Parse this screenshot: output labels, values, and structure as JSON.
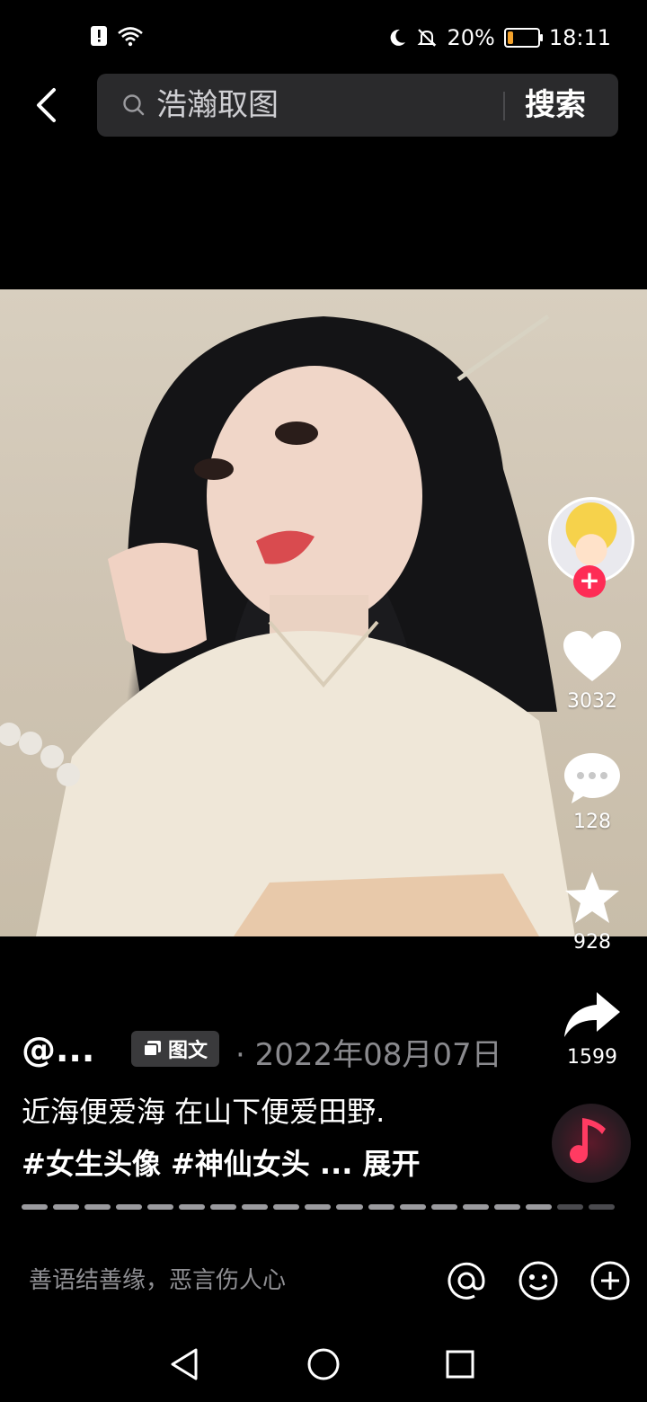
{
  "status_bar": {
    "battery": "20%",
    "time": "18:11",
    "battery_level": 0.2
  },
  "search": {
    "query": "浩瀚取图",
    "button": "搜索"
  },
  "post": {
    "username": "@...",
    "type_badge": "图文",
    "separator": "·",
    "date": "2022年08月07日",
    "caption_line1": "近海便爱海 在山下便爱田野.",
    "caption_line2": "#女生头像 #神仙女头 ...",
    "expand": "展开",
    "progress": {
      "total": 19,
      "current": 17
    }
  },
  "actions": {
    "likes": "3032",
    "comments": "128",
    "favorites": "928",
    "shares": "1599"
  },
  "comment_bar": {
    "placeholder": "善语结善缘，恶言伤人心"
  },
  "colors": {
    "accent_red": "#fe2c55",
    "background": "#000000"
  }
}
